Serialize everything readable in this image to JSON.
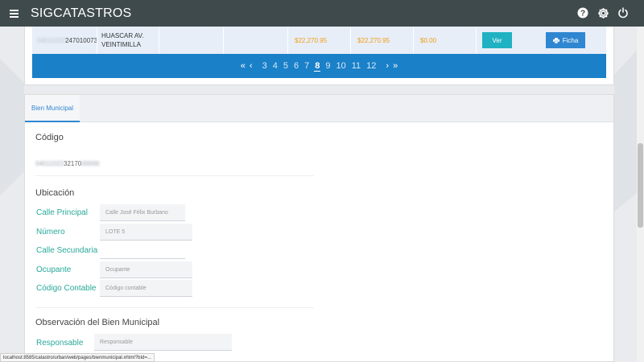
{
  "header": {
    "title": "SIGCATASTROS",
    "icons": [
      "help-icon",
      "settings-icon",
      "power-icon"
    ]
  },
  "table": {
    "row": {
      "code_masked": "04011022",
      "code_visible": "247010073",
      "address_line1": "HUASCAR AV.",
      "address_line2": "VEINTIMILLA",
      "amount1": "$22,270.95",
      "amount2": "$22,270.95",
      "amount3": "$0.00",
      "ver_label": "Ver",
      "ficha_label": "Ficha"
    },
    "pagination": {
      "pages": [
        "3",
        "4",
        "5",
        "6",
        "7",
        "8",
        "9",
        "10",
        "11",
        "12"
      ],
      "active": "8"
    }
  },
  "detail": {
    "tab_label": "Bien Municipal",
    "codigo_title": "Código",
    "codigo_masked_prefix": "04011022",
    "codigo_visible": "32170",
    "codigo_masked_suffix": "00000",
    "ubicacion_title": "Ubicación",
    "fields": {
      "calle_principal_label": "Calle Principal",
      "calle_principal_value": "Calle José Félix Burbano",
      "numero_label": "Número",
      "numero_value": "LOTE 5",
      "calle_secundaria_label": "Calle Secundaria",
      "calle_secundaria_value": "",
      "ocupante_label": "Ocupante",
      "ocupante_placeholder": "Ocupante",
      "codigo_contable_label": "Código Contable",
      "codigo_contable_placeholder": "Código contable"
    },
    "observacion_title": "Observación del Bien Municipal",
    "responsable_label": "Responsable",
    "responsable_placeholder": "Responsable"
  },
  "status_bar": {
    "url": "localhost:8585/catastro/urban/web/pages/bienmunicipal.xhtml?bId=..."
  },
  "colors": {
    "header_bg": "#3f4a4c",
    "accent_blue": "#1a80c8",
    "label_teal": "#28a99a",
    "amount_orange": "#f39c12",
    "ver_button": "#20b2c2"
  }
}
